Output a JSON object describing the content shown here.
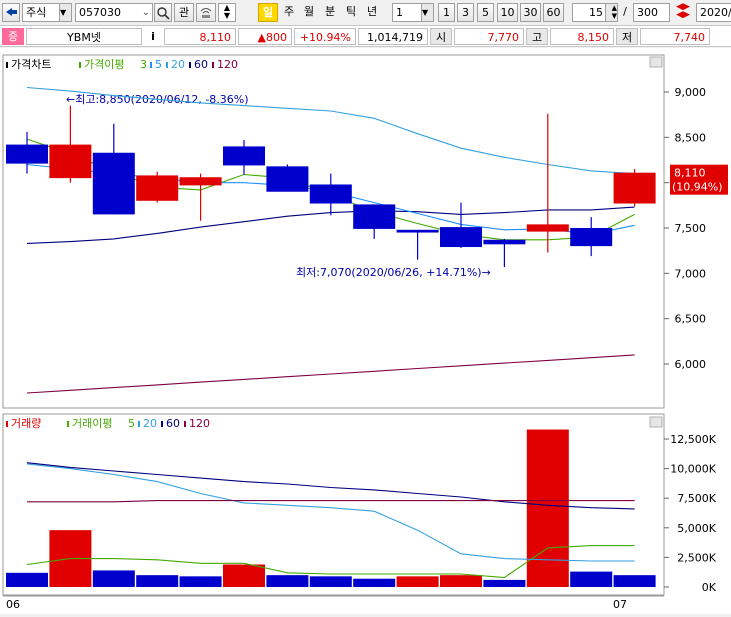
{
  "toolbar": {
    "menu_icon": "hamburger-icon",
    "market_select": "주식",
    "code_input": "057030",
    "relation_btn": "관",
    "period_selected": "일",
    "periods": [
      "주",
      "월",
      "분",
      "틱",
      "년"
    ],
    "interval_select": "1",
    "quick_ranges": [
      "1",
      "3",
      "5",
      "10",
      "30",
      "60"
    ],
    "count_value": "15",
    "count_total": "300",
    "date_value": "2020/"
  },
  "quote": {
    "badge": "증",
    "name": "YBM넷",
    "info_btn": "i",
    "price": "8,110",
    "change": "▲800",
    "change_pct": "+10.94%",
    "volume": "1,014,719",
    "open_label": "시",
    "open": "7,770",
    "high_label": "고",
    "high": "8,150",
    "low_label": "저",
    "low": "7,740"
  },
  "price_legend": {
    "title": "가격차트",
    "ma_title": "가격이평",
    "ma_periods": [
      "3",
      "5",
      "20",
      "60",
      "120"
    ]
  },
  "volume_legend": {
    "title": "거래량",
    "ma_title": "거래이평",
    "ma_periods": [
      "5",
      "20",
      "60",
      "120"
    ]
  },
  "annotations": {
    "high": "←최고:8,850(2020/06/12, -8.36%)",
    "low": "최저:7,070(2020/06/26, +14.71%)→",
    "last_price": "8,110",
    "last_pct": "(10.94%)"
  },
  "x_labels": [
    "06",
    "07"
  ],
  "colors": {
    "up": "#e00000",
    "down": "#0000cc",
    "ma3": "#44aa00",
    "ma5": "#1e90ff",
    "ma20": "#33a0e0",
    "ma60": "#000080",
    "ma120": "#800040"
  },
  "chart_data": [
    {
      "type": "candlestick",
      "title": "가격차트",
      "ylim": [
        5600,
        9500
      ],
      "yticks": [
        "9,000",
        "8,500",
        "8,000",
        "7,500",
        "7,000",
        "6,500",
        "6,000"
      ],
      "candles": [
        {
          "o": 8420,
          "h": 8560,
          "l": 8100,
          "c": 8210
        },
        {
          "o": 8050,
          "h": 8850,
          "l": 8000,
          "c": 8420
        },
        {
          "o": 8330,
          "h": 8650,
          "l": 7650,
          "c": 7650
        },
        {
          "o": 7800,
          "h": 8120,
          "l": 7780,
          "c": 8080
        },
        {
          "o": 7970,
          "h": 8100,
          "l": 7580,
          "c": 8060
        },
        {
          "o": 8400,
          "h": 8470,
          "l": 8090,
          "c": 8190
        },
        {
          "o": 8180,
          "h": 8200,
          "l": 7930,
          "c": 7900
        },
        {
          "o": 7980,
          "h": 8100,
          "l": 7640,
          "c": 7770
        },
        {
          "o": 7760,
          "h": 7760,
          "l": 7380,
          "c": 7490
        },
        {
          "o": 7480,
          "h": 7480,
          "l": 7150,
          "c": 7450
        },
        {
          "o": 7510,
          "h": 7780,
          "l": 7280,
          "c": 7290
        },
        {
          "o": 7370,
          "h": 7380,
          "l": 7070,
          "c": 7320
        },
        {
          "o": 7460,
          "h": 8760,
          "l": 7230,
          "c": 7540
        },
        {
          "o": 7500,
          "h": 7620,
          "l": 7190,
          "c": 7300
        },
        {
          "o": 7770,
          "h": 8150,
          "l": 7740,
          "c": 8110
        }
      ],
      "series": [
        {
          "name": "3",
          "values": [
            8480,
            8320,
            8120,
            7950,
            7920,
            8090,
            8050,
            7870,
            7680,
            7550,
            7430,
            7370,
            7370,
            7400,
            7650
          ]
        },
        {
          "name": "60",
          "values": [
            7330,
            7350,
            7380,
            7440,
            7510,
            7570,
            7630,
            7670,
            7690,
            7680,
            7650,
            7670,
            7700,
            7700,
            7730
          ]
        },
        {
          "name": "20",
          "values": [
            9050,
            9010,
            8960,
            8920,
            8880,
            8850,
            8820,
            8790,
            8710,
            8540,
            8380,
            8280,
            8200,
            8130,
            8100
          ]
        },
        {
          "name": "5",
          "values": [
            8200,
            8150,
            8100,
            8050,
            8000,
            8000,
            7970,
            7900,
            7780,
            7660,
            7540,
            7480,
            7490,
            7430,
            7530
          ]
        },
        {
          "name": "120",
          "values": [
            5680,
            5710,
            5740,
            5770,
            5800,
            5830,
            5860,
            5890,
            5920,
            5950,
            5980,
            6010,
            6040,
            6070,
            6100
          ]
        }
      ]
    },
    {
      "type": "bar",
      "title": "거래량",
      "ylim": [
        0,
        13300
      ],
      "yticks": [
        "12,500K",
        "10,000K",
        "7,500K",
        "5,000K",
        "2,500K",
        "0K"
      ],
      "values": [
        1200,
        4800,
        1400,
        1000,
        900,
        1900,
        1000,
        900,
        700,
        900,
        1000,
        600,
        13300,
        1300,
        1000
      ],
      "up": [
        false,
        true,
        false,
        false,
        false,
        true,
        false,
        false,
        false,
        true,
        true,
        false,
        true,
        false,
        false
      ],
      "series": [
        {
          "name": "5",
          "values": [
            1900,
            2400,
            2400,
            2300,
            2000,
            2000,
            1200,
            1100,
            1100,
            1100,
            1100,
            800,
            3300,
            3500,
            3500
          ]
        },
        {
          "name": "20",
          "values": [
            10400,
            10000,
            9500,
            8900,
            7900,
            7100,
            6900,
            6700,
            6400,
            4800,
            2800,
            2400,
            2300,
            2200,
            2200
          ]
        },
        {
          "name": "60",
          "values": [
            10500,
            10100,
            9800,
            9500,
            9200,
            8900,
            8700,
            8400,
            8200,
            7900,
            7600,
            7200,
            6900,
            6700,
            6600
          ]
        },
        {
          "name": "120",
          "values": [
            7200,
            7200,
            7200,
            7300,
            7300,
            7300,
            7300,
            7300,
            7300,
            7300,
            7300,
            7300,
            7300,
            7300,
            7300
          ]
        }
      ]
    }
  ]
}
